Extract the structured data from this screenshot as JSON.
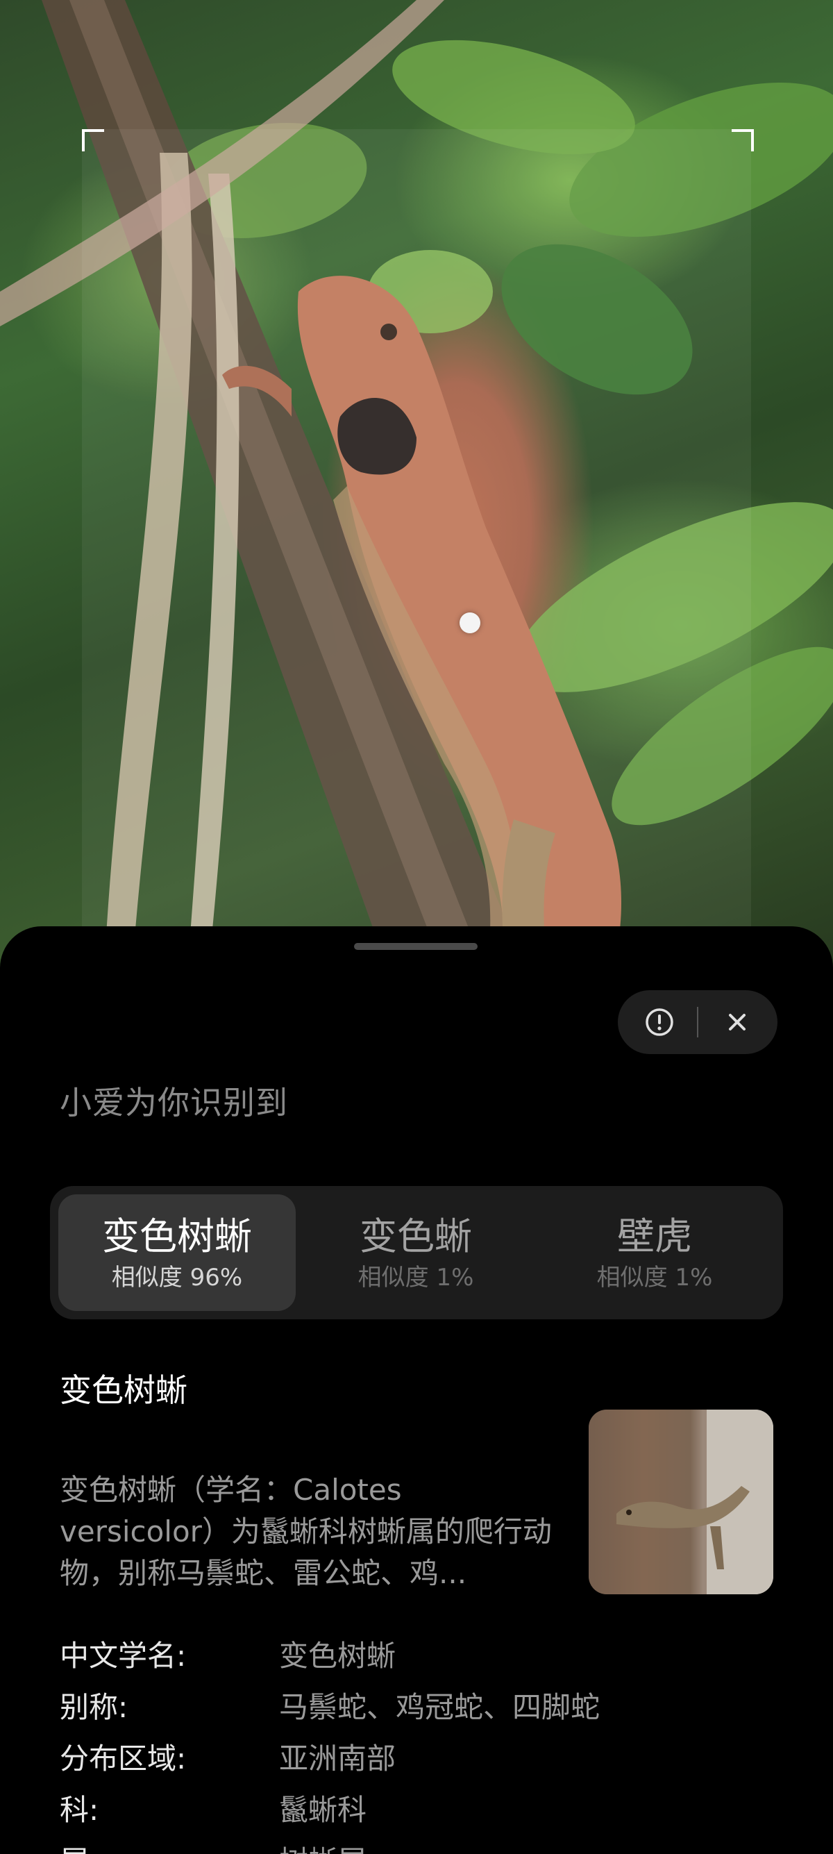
{
  "header": {
    "intro_text": "小爱为你识别到"
  },
  "actions": {
    "info_icon": "info-circle-icon",
    "close_icon": "close-icon"
  },
  "results": [
    {
      "name": "变色树蜥",
      "similarity": "相似度 96%",
      "selected": true
    },
    {
      "name": "变色蜥",
      "similarity": "相似度 1%",
      "selected": false
    },
    {
      "name": "壁虎",
      "similarity": "相似度 1%",
      "selected": false
    }
  ],
  "detail": {
    "title": "变色树蜥",
    "description": "变色树蜥（学名：Calotes versicolor）为鬣蜥科树蜥属的爬行动物，别称马鬃蛇、雷公蛇、鸡...",
    "facts": [
      {
        "label": "中文学名:",
        "value": "变色树蜥"
      },
      {
        "label": "别称:",
        "value": "马鬃蛇、鸡冠蛇、四脚蛇"
      },
      {
        "label": "分布区域:",
        "value": "亚洲南部"
      },
      {
        "label": "科:",
        "value": "鬣蜥科"
      },
      {
        "label": "属:",
        "value": "树蜥属"
      }
    ]
  },
  "colors": {
    "sheet_background": "#000000",
    "tab_container": "#1c1c1c",
    "tab_selected": "#363636"
  }
}
